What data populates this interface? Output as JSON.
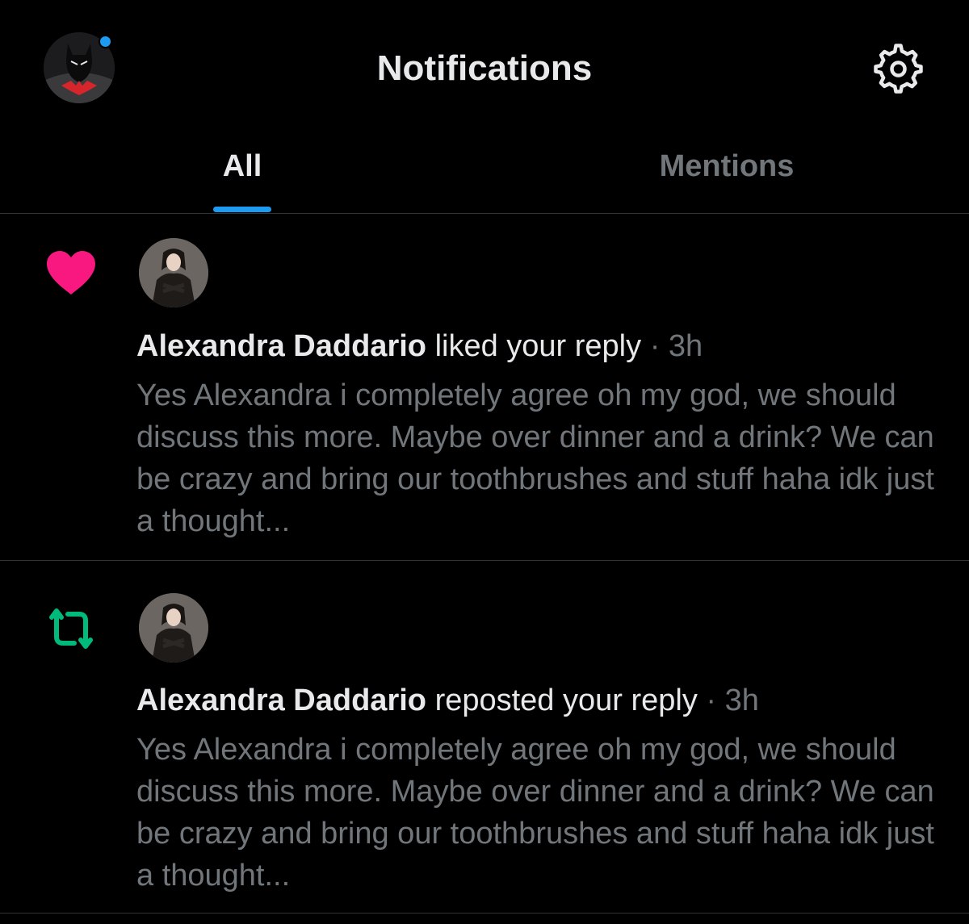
{
  "header": {
    "title": "Notifications",
    "avatar_icon": "batman-beyond-avatar",
    "settings_icon": "gear-icon",
    "unread_dot_color": "#1d9bf0"
  },
  "tabs": [
    {
      "label": "All",
      "active": true
    },
    {
      "label": "Mentions",
      "active": false
    }
  ],
  "notifications": [
    {
      "type": "like",
      "icon": "heart-icon",
      "icon_color": "#f91880",
      "user": "Alexandra Daddario",
      "action": "liked your reply",
      "separator": "·",
      "time": "3h",
      "text": "Yes Alexandra i completely agree oh my god, we should discuss this more. Maybe over dinner and a drink? We can be crazy and bring our toothbrushes and stuff haha idk just a thought..."
    },
    {
      "type": "repost",
      "icon": "repost-icon",
      "icon_color": "#00ba7c",
      "user": "Alexandra Daddario",
      "action": "reposted your reply",
      "separator": "·",
      "time": "3h",
      "text": "Yes Alexandra i completely agree oh my god, we should discuss this more. Maybe over dinner and a drink? We can be crazy and bring our toothbrushes and stuff haha idk just a thought..."
    }
  ],
  "colors": {
    "background": "#000000",
    "primary_text": "#e7e9ea",
    "secondary_text": "#71767b",
    "accent": "#1d9bf0",
    "divider": "#2f3336"
  }
}
